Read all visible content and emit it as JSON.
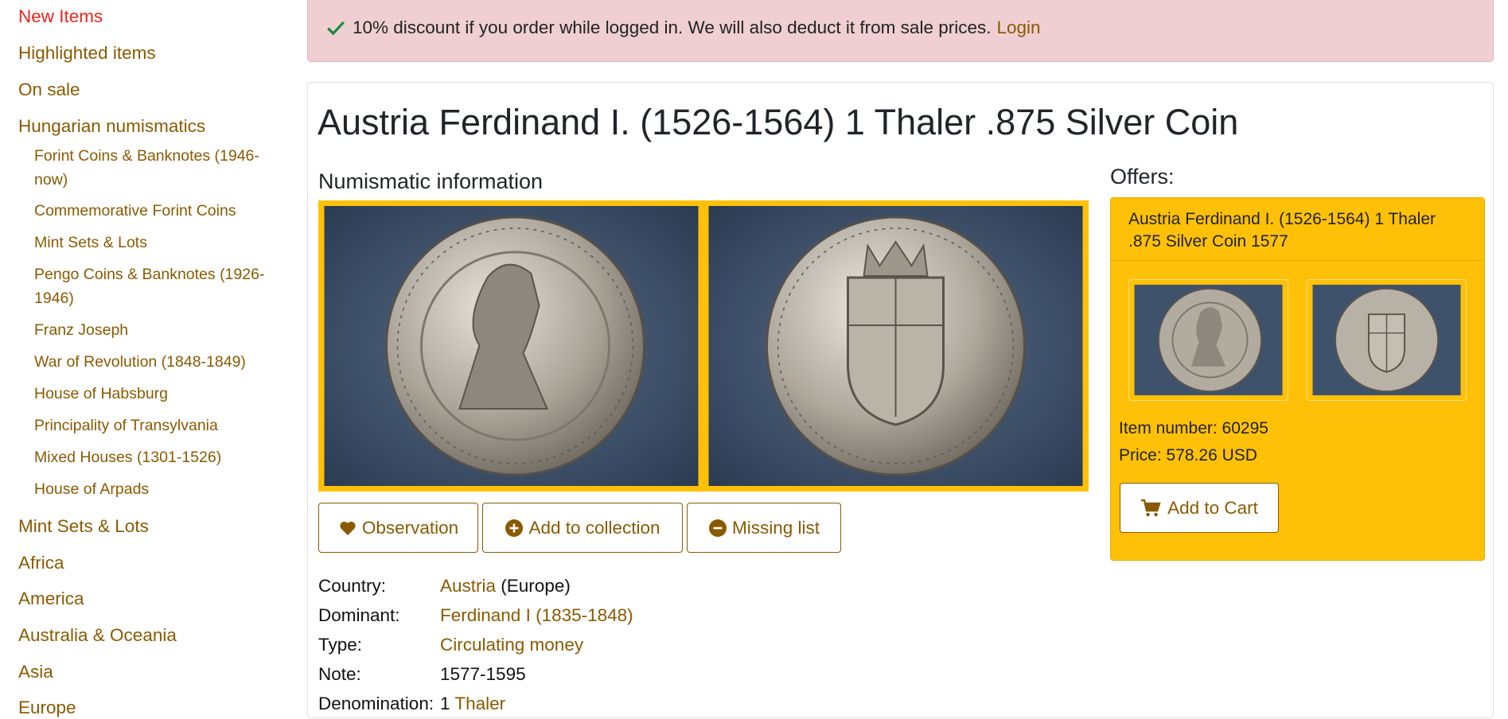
{
  "sidebar": {
    "top_items": [
      "New Items",
      "Highlighted items",
      "On sale",
      "Hungarian numismatics"
    ],
    "sub_items": [
      "Forint Coins & Banknotes (1946-now)",
      "Commemorative Forint Coins",
      "Mint Sets & Lots",
      "Pengo Coins & Banknotes (1926-1946)",
      "Franz Joseph",
      "War of Revolution (1848-1849)",
      "House of Habsburg",
      "Principality of Transylvania",
      "Mixed Houses (1301-1526)",
      "House of Arpads"
    ],
    "bottom_items": [
      "Mint Sets & Lots",
      "Africa",
      "America",
      "Australia & Oceania",
      "Asia",
      "Europe"
    ]
  },
  "alert": {
    "text": "10% discount if you order while logged in. We will also deduct it from sale prices.",
    "link": "Login"
  },
  "product": {
    "title": "Austria Ferdinand I. (1526-1564) 1 Thaler .875 Silver Coin",
    "numismatic_heading": "Numismatic information",
    "buttons": {
      "observation": "Observation",
      "add_collection": "Add to collection",
      "missing_list": "Missing list"
    },
    "info": {
      "country_label": "Country:",
      "country_value": "Austria",
      "country_suffix": "(Europe)",
      "dominant_label": "Dominant:",
      "dominant_value": "Ferdinand I (1835-1848)",
      "type_label": "Type:",
      "type_value": "Circulating money",
      "note_label": "Note:",
      "note_value": "1577-1595",
      "denomination_label": "Denomination:",
      "denomination_number": "1",
      "denomination_value": "Thaler"
    }
  },
  "offers": {
    "heading": "Offers:",
    "offer_title": "Austria Ferdinand I. (1526-1564) 1 Thaler .875 Silver Coin 1577",
    "item_number": "Item number: 60295",
    "price": "Price: 578.26 USD",
    "cart_label": "Add to Cart"
  },
  "colors": {
    "link": "#8a5a00",
    "active": "#e8251b",
    "alert_bg": "#efcfd1",
    "accent": "#ffc107"
  },
  "icons": [
    "check-icon",
    "heart-icon",
    "plus-circle-icon",
    "minus-circle-icon",
    "cart-icon"
  ]
}
